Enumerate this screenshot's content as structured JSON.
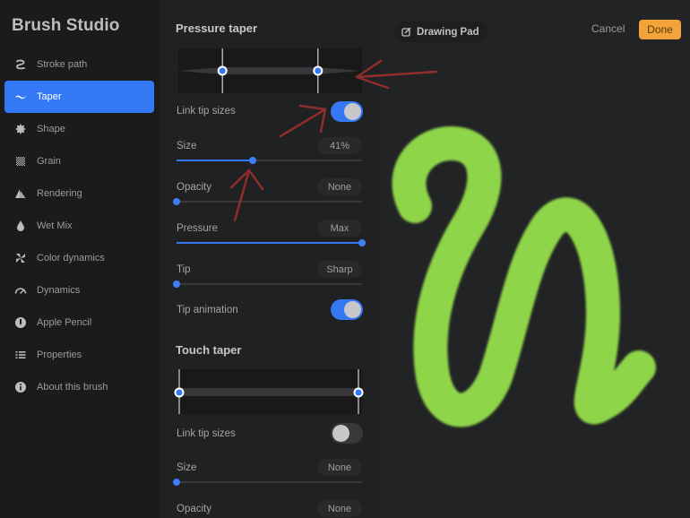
{
  "sidebar": {
    "title": "Brush Studio",
    "items": [
      {
        "label": "Stroke path",
        "icon": "stroke-path-icon",
        "active": false
      },
      {
        "label": "Taper",
        "icon": "taper-icon",
        "active": true
      },
      {
        "label": "Shape",
        "icon": "shape-icon",
        "active": false
      },
      {
        "label": "Grain",
        "icon": "grain-icon",
        "active": false
      },
      {
        "label": "Rendering",
        "icon": "rendering-icon",
        "active": false
      },
      {
        "label": "Wet Mix",
        "icon": "wet-mix-icon",
        "active": false
      },
      {
        "label": "Color dynamics",
        "icon": "color-dynamics-icon",
        "active": false
      },
      {
        "label": "Dynamics",
        "icon": "dynamics-icon",
        "active": false
      },
      {
        "label": "Apple Pencil",
        "icon": "apple-pencil-icon",
        "active": false
      },
      {
        "label": "Properties",
        "icon": "properties-icon",
        "active": false
      },
      {
        "label": "About this brush",
        "icon": "info-icon",
        "active": false
      }
    ]
  },
  "pressure_taper": {
    "title": "Pressure taper",
    "start_handle": 0.24,
    "end_handle": 0.76,
    "link_tip_sizes": {
      "label": "Link tip sizes",
      "on": true
    },
    "size": {
      "label": "Size",
      "value": "41%",
      "fraction": 0.41
    },
    "opacity": {
      "label": "Opacity",
      "value": "None",
      "fraction": 0.0
    },
    "pressure": {
      "label": "Pressure",
      "value": "Max",
      "fraction": 1.0
    },
    "tip": {
      "label": "Tip",
      "value": "Sharp",
      "fraction": 0.0
    },
    "tip_animation": {
      "label": "Tip animation",
      "on": true
    }
  },
  "touch_taper": {
    "title": "Touch taper",
    "start_handle": 0.0,
    "end_handle": 1.0,
    "link_tip_sizes": {
      "label": "Link tip sizes",
      "on": false
    },
    "size": {
      "label": "Size",
      "value": "None",
      "fraction": 0.0
    },
    "opacity": {
      "label": "Opacity",
      "value": "None"
    }
  },
  "canvas": {
    "drawing_pad_label": "Drawing Pad",
    "cancel_label": "Cancel",
    "done_label": "Done",
    "stroke_color": "#8fd548",
    "accent_color": "#3478f6",
    "done_color": "#f2a33a",
    "annotation_color": "#a3302f"
  }
}
